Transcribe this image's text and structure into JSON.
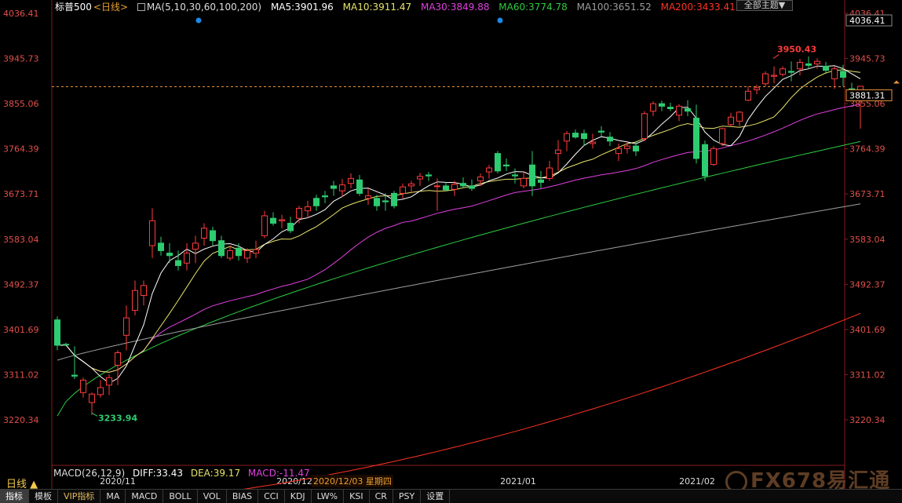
{
  "header": {
    "symbol": "标普500",
    "period_tag": "<日线>",
    "ma_label": "MA(5,10,30,60,100,200)",
    "ma5": "MA5:3901.96",
    "ma10": "MA10:3911.47",
    "ma30": "MA30:3849.88",
    "ma60": "MA60:3774.78",
    "ma100": "MA100:3651.52",
    "ma200": "MA200:3433.41",
    "dropdown": "全部主题▼"
  },
  "indicator": {
    "macd": "MACD(26,12,9)",
    "diff": "DIFF:33.43",
    "dea": "DEA:39.17",
    "macd_val": "MACD:-11.47",
    "date_tag": "2020/12/03 星期四"
  },
  "period_label": "日线 ▲",
  "tabs": [
    "指标",
    "模板",
    "VIP指标",
    "MA",
    "MACD",
    "BOLL",
    "VOL",
    "BIAS",
    "CCI",
    "KDJ",
    "LW%",
    "KSI",
    "CR",
    "PSY",
    "设置"
  ],
  "watermark": "FX678易汇通",
  "colors": {
    "up": "#ff3b3b",
    "down": "#2ecc71",
    "ma5": "#ffffff",
    "ma10": "#e8e36a",
    "ma30": "#e040e0",
    "ma60": "#2ecc40",
    "ma100": "#9e9e9e",
    "ma200": "#ff3322"
  },
  "chart_data": {
    "type": "candlestick",
    "y_ticks": [
      "4036.41",
      "3945.73",
      "3855.06",
      "3764.39",
      "3673.71",
      "3583.04",
      "3492.37",
      "3401.69",
      "3311.02",
      "3220.34"
    ],
    "ylim": [
      3220.34,
      4036.41
    ],
    "x_labels": [
      "2020/11",
      "2020/12",
      "2021/01",
      "2021/02"
    ],
    "high_label": "3950.43",
    "low_label": "3233.94",
    "top_axis_value": "4036.41",
    "last_price": "3881.31",
    "ohlc": [
      [
        3421,
        3428,
        3360,
        3370
      ],
      [
        3372,
        3375,
        3369,
        3371
      ],
      [
        3310,
        3368,
        3302,
        3308
      ],
      [
        3275,
        3305,
        3265,
        3300
      ],
      [
        3255,
        3275,
        3230,
        3272
      ],
      [
        3271,
        3300,
        3265,
        3285
      ],
      [
        3290,
        3312,
        3270,
        3305
      ],
      [
        3330,
        3360,
        3290,
        3355
      ],
      [
        3390,
        3450,
        3360,
        3425
      ],
      [
        3440,
        3500,
        3430,
        3480
      ],
      [
        3470,
        3500,
        3450,
        3490
      ],
      [
        3570,
        3645,
        3545,
        3620
      ],
      [
        3575,
        3588,
        3550,
        3560
      ],
      [
        3555,
        3575,
        3535,
        3550
      ],
      [
        3540,
        3560,
        3520,
        3530
      ],
      [
        3535,
        3575,
        3520,
        3555
      ],
      [
        3563,
        3590,
        3535,
        3575
      ],
      [
        3585,
        3615,
        3570,
        3605
      ],
      [
        3600,
        3608,
        3570,
        3580
      ],
      [
        3580,
        3590,
        3545,
        3550
      ],
      [
        3545,
        3570,
        3540,
        3560
      ],
      [
        3565,
        3575,
        3540,
        3550
      ],
      [
        3545,
        3565,
        3535,
        3560
      ],
      [
        3555,
        3580,
        3545,
        3562
      ],
      [
        3590,
        3640,
        3585,
        3630
      ],
      [
        3625,
        3637,
        3610,
        3615
      ],
      [
        3620,
        3632,
        3605,
        3622
      ],
      [
        3615,
        3628,
        3595,
        3600
      ],
      [
        3625,
        3650,
        3615,
        3645
      ],
      [
        3640,
        3660,
        3625,
        3648
      ],
      [
        3665,
        3672,
        3640,
        3650
      ],
      [
        3670,
        3680,
        3655,
        3668
      ],
      [
        3690,
        3700,
        3670,
        3685
      ],
      [
        3680,
        3704,
        3668,
        3692
      ],
      [
        3695,
        3715,
        3685,
        3705
      ],
      [
        3702,
        3712,
        3670,
        3675
      ],
      [
        3665,
        3685,
        3652,
        3670
      ],
      [
        3665,
        3672,
        3640,
        3650
      ],
      [
        3660,
        3675,
        3640,
        3658
      ],
      [
        3675,
        3680,
        3645,
        3650
      ],
      [
        3675,
        3695,
        3665,
        3688
      ],
      [
        3690,
        3700,
        3675,
        3694
      ],
      [
        3704,
        3716,
        3690,
        3709
      ],
      [
        3712,
        3718,
        3700,
        3710
      ],
      [
        3690,
        3705,
        3640,
        3690
      ],
      [
        3690,
        3697,
        3680,
        3682
      ],
      [
        3683,
        3700,
        3670,
        3693
      ],
      [
        3695,
        3707,
        3685,
        3690
      ],
      [
        3690,
        3703,
        3680,
        3685
      ],
      [
        3700,
        3715,
        3690,
        3708
      ],
      [
        3718,
        3732,
        3705,
        3726
      ],
      [
        3755,
        3760,
        3715,
        3720
      ],
      [
        3732,
        3745,
        3720,
        3730
      ],
      [
        3712,
        3725,
        3695,
        3710
      ],
      [
        3690,
        3720,
        3685,
        3705
      ],
      [
        3732,
        3760,
        3670,
        3690
      ],
      [
        3702,
        3720,
        3685,
        3697
      ],
      [
        3705,
        3740,
        3700,
        3726
      ],
      [
        3755,
        3782,
        3720,
        3762
      ],
      [
        3780,
        3800,
        3760,
        3795
      ],
      [
        3796,
        3803,
        3785,
        3788
      ],
      [
        3795,
        3803,
        3770,
        3785
      ],
      [
        3775,
        3795,
        3765,
        3778
      ],
      [
        3800,
        3810,
        3790,
        3798
      ],
      [
        3788,
        3798,
        3770,
        3780
      ],
      [
        3755,
        3775,
        3740,
        3765
      ],
      [
        3765,
        3778,
        3755,
        3770
      ],
      [
        3770,
        3780,
        3750,
        3760
      ],
      [
        3785,
        3840,
        3780,
        3835
      ],
      [
        3840,
        3860,
        3830,
        3855
      ],
      [
        3855,
        3861,
        3840,
        3850
      ],
      [
        3848,
        3857,
        3840,
        3845
      ],
      [
        3832,
        3854,
        3820,
        3850
      ],
      [
        3845,
        3862,
        3830,
        3840
      ],
      [
        3826,
        3853,
        3735,
        3745
      ],
      [
        3773,
        3781,
        3700,
        3710
      ],
      [
        3733,
        3770,
        3730,
        3765
      ],
      [
        3775,
        3807,
        3770,
        3805
      ],
      [
        3813,
        3837,
        3810,
        3828
      ],
      [
        3820,
        3840,
        3810,
        3838
      ],
      [
        3862,
        3890,
        3860,
        3880
      ],
      [
        3883,
        3893,
        3874,
        3887
      ],
      [
        3895,
        3920,
        3890,
        3915
      ],
      [
        3910,
        3930,
        3896,
        3912
      ],
      [
        3914,
        3930,
        3910,
        3925
      ],
      [
        3920,
        3940,
        3900,
        3918
      ],
      [
        3925,
        3945,
        3912,
        3938
      ],
      [
        3935,
        3950,
        3925,
        3932
      ],
      [
        3935,
        3946,
        3925,
        3940
      ],
      [
        3930,
        3939,
        3915,
        3922
      ],
      [
        3905,
        3930,
        3885,
        3925
      ],
      [
        3920,
        3933,
        3890,
        3908
      ],
      [
        3885,
        3897,
        3875,
        3880
      ],
      [
        3862,
        3890,
        3805,
        3890
      ]
    ]
  }
}
